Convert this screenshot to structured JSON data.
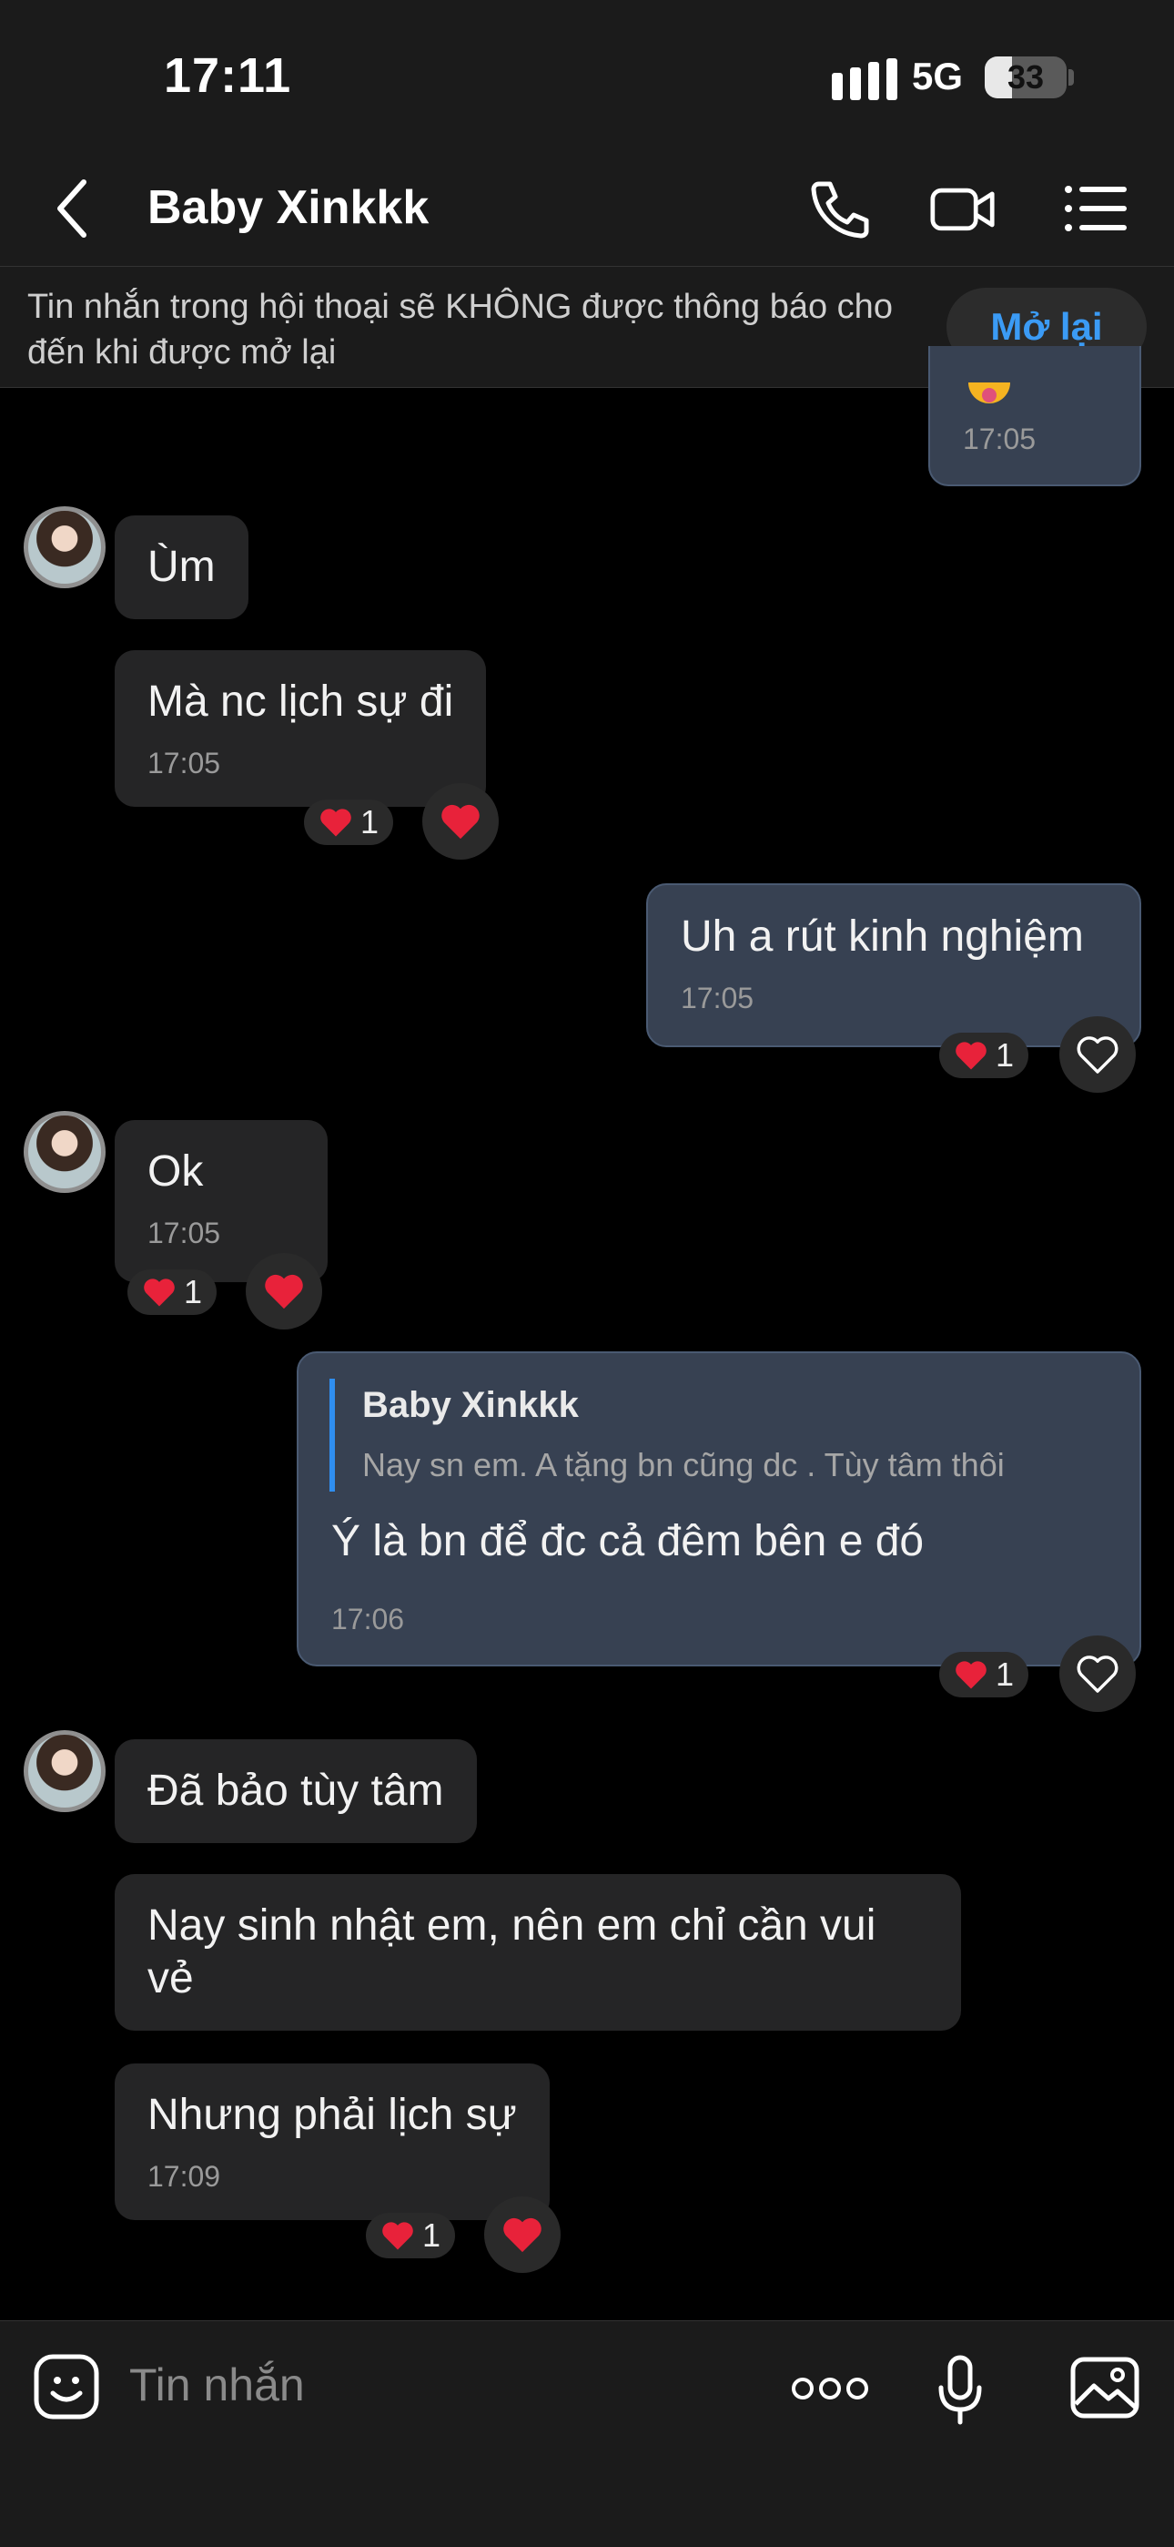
{
  "status_bar": {
    "time": "17:11",
    "network": "5G",
    "battery": "33",
    "battery_level": 0.33
  },
  "header": {
    "title": "Baby Xinkkk"
  },
  "banner": {
    "text": "Tin nhắn trong hội thoại sẽ KHÔNG được thông báo cho đến khi được mở lại",
    "button": "Mở lại"
  },
  "messages": [
    {
      "time": "17:05"
    },
    {
      "text": "Ùm"
    },
    {
      "text": "Mà nc lịch sự đi",
      "time": "17:05",
      "reaction_count": "1"
    },
    {
      "text": "Uh a rút kinh nghiệm",
      "time": "17:05",
      "reaction_count": "1"
    },
    {
      "text": "Ok",
      "time": "17:05",
      "reaction_count": "1"
    },
    {
      "quote_name": "Baby Xinkkk",
      "quote_text": "Nay sn em. A tặng bn cũng dc . Tùy tâm thôi",
      "text": "Ý là bn để đc cả đêm bên e đó",
      "time": "17:06",
      "reaction_count": "1"
    },
    {
      "text": "Đã bảo tùy tâm"
    },
    {
      "text": "Nay sinh nhật em, nên em chỉ cần vui vẻ"
    },
    {
      "text": "Nhưng phải lịch sự",
      "time": "17:09",
      "reaction_count": "1"
    }
  ],
  "input": {
    "placeholder": "Tin nhắn"
  },
  "colors": {
    "accent": "#3b9bf5",
    "heart": "#e8223a",
    "outgoing_bubble": "#374152",
    "incoming_bubble": "#252526"
  }
}
